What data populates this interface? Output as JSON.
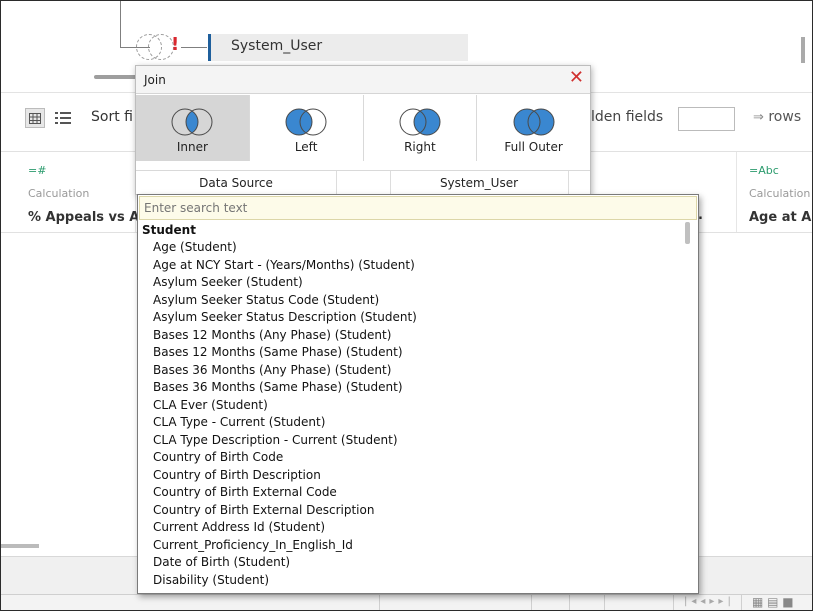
{
  "canvas": {
    "table_name": "System_User"
  },
  "toolbar": {
    "sort_label": "Sort fi",
    "hidden_label": "lden fields",
    "rows_label": "rows"
  },
  "grid": {
    "columns": [
      {
        "type": "=#",
        "kind": "Calculation",
        "name": "% Appeals vs Ap"
      },
      {
        "type": "=Abc",
        "kind": "Calculation",
        "name": "Age at Ap"
      }
    ],
    "truncated_col": "."
  },
  "join_dialog": {
    "title": "Join",
    "types": [
      {
        "label": "Inner",
        "selected": true
      },
      {
        "label": "Left",
        "selected": false
      },
      {
        "label": "Right",
        "selected": false
      },
      {
        "label": "Full Outer",
        "selected": false
      }
    ],
    "left_header": "Data Source",
    "right_header": "System_User",
    "accent": "#3a87d0"
  },
  "search": {
    "placeholder": "Enter search text",
    "group": "Student",
    "items": [
      "Age (Student)",
      "Age at NCY Start - (Years/Months) (Student)",
      "Asylum Seeker (Student)",
      "Asylum Seeker Status Code (Student)",
      "Asylum Seeker Status Description (Student)",
      "Bases 12 Months (Any Phase) (Student)",
      "Bases 12 Months (Same Phase) (Student)",
      "Bases 36 Months (Any Phase) (Student)",
      "Bases 36 Months (Same Phase) (Student)",
      "CLA Ever (Student)",
      "CLA Type - Current (Student)",
      "CLA Type Description - Current (Student)",
      "Country of Birth Code",
      "Country of Birth Description",
      "Country of Birth External Code",
      "Country of Birth External Description",
      "Current Address Id (Student)",
      "Current_Proficiency_In_English_Id",
      "Date of Birth (Student)",
      "Disability (Student)"
    ]
  }
}
